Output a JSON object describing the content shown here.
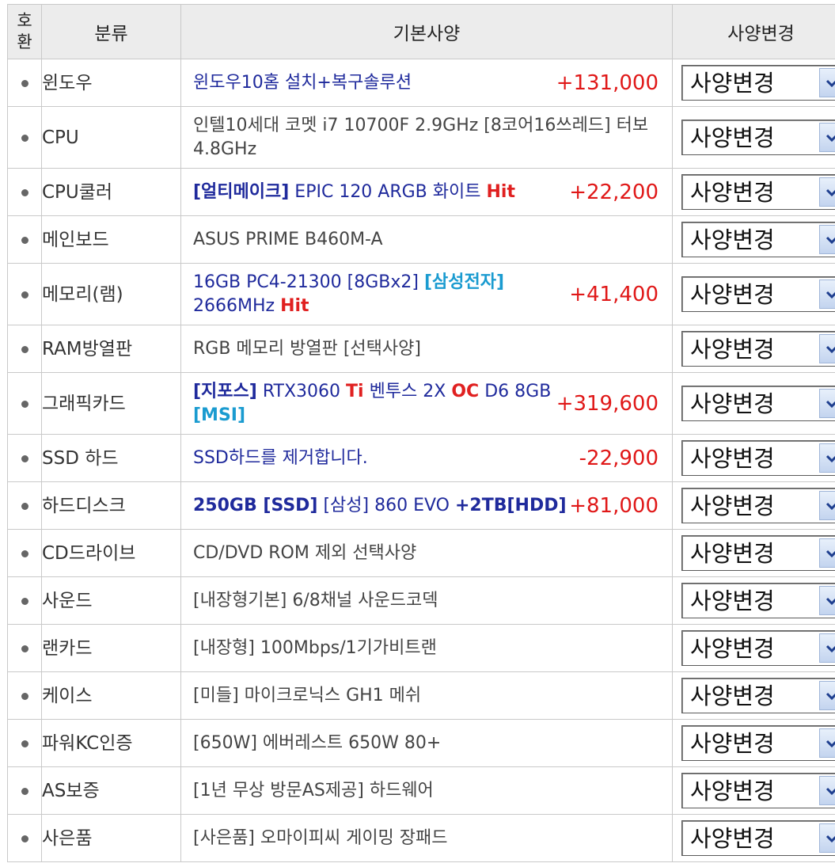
{
  "header": {
    "no_line1": "호",
    "no_line2": "환",
    "category": "분류",
    "spec": "기본사양",
    "change": "사양변경"
  },
  "select_label": "사양변경",
  "colors": {
    "price": "#e01818",
    "blue": "#1f2a9c",
    "red": "#e02020",
    "cyan": "#1a9bd0"
  },
  "rows": [
    {
      "category": "윈도우",
      "spec": "윈도우10홈 설치+복구솔루션",
      "price": "+131,000"
    },
    {
      "category": "CPU",
      "spec": "인텔10세대 코멧 i7 10700F 2.9GHz [8코어16쓰레드] 터보4.8GHz",
      "price": ""
    },
    {
      "category": "CPU쿨러",
      "spec_b1": "[얼티메이크]",
      "spec_t1": " EPIC 120 ARGB 화이트 ",
      "spec_h1": "Hit",
      "price": "+22,200"
    },
    {
      "category": "메인보드",
      "spec": "ASUS PRIME B460M-A",
      "price": ""
    },
    {
      "category": "메모리(램)",
      "spec_t1": "16GB PC4-21300 [8GBx2] ",
      "spec_c1": "[삼성전자]",
      "spec_t2": " 2666MHz ",
      "spec_h1": "Hit",
      "price": "+41,400"
    },
    {
      "category": "RAM방열판",
      "spec": "RGB 메모리 방열판 [선택사양]",
      "price": ""
    },
    {
      "category": "그래픽카드",
      "spec_b1": "[지포스]",
      "spec_t1": " RTX3060 ",
      "spec_h1": "Ti",
      "spec_t2": " 벤투스 2X ",
      "spec_h2": "OC",
      "spec_t3": " D6 8GB ",
      "spec_c1": "[MSI]",
      "price": "+319,600"
    },
    {
      "category": "SSD 하드",
      "spec": "SSD하드를 제거합니다.",
      "price": "-22,900"
    },
    {
      "category": "하드디스크",
      "spec_b1": "250GB [SSD]",
      "spec_t1": " [삼성] 860 EVO ",
      "spec_b2": "+2TB[HDD]",
      "price": "+81,000"
    },
    {
      "category": "CD드라이브",
      "spec": "CD/DVD ROM 제외 선택사양",
      "price": ""
    },
    {
      "category": "사운드",
      "spec": "[내장형기본] 6/8채널 사운드코덱",
      "price": ""
    },
    {
      "category": "랜카드",
      "spec": "[내장형] 100Mbps/1기가비트랜",
      "price": ""
    },
    {
      "category": "케이스",
      "spec": "[미들] 마이크로닉스 GH1 메쉬",
      "price": ""
    },
    {
      "category": "파워KC인증",
      "spec": "[650W] 에버레스트 650W 80+",
      "price": ""
    },
    {
      "category": "AS보증",
      "spec": "[1년 무상 방문AS제공] 하드웨어",
      "price": ""
    },
    {
      "category": "사은품",
      "spec": "[사은품] 오마이피씨 게이밍 장패드",
      "price": ""
    }
  ]
}
